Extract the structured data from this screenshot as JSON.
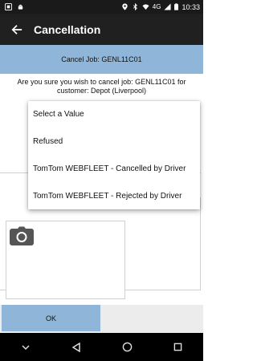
{
  "status_bar": {
    "time": "10:33",
    "network": "4G",
    "left_icons": [
      "app-notification-icon",
      "android-icon"
    ],
    "right_icons": [
      "location-icon",
      "bluetooth-icon",
      "wifi-icon",
      "signal-icon",
      "battery-icon"
    ]
  },
  "app_bar": {
    "title": "Cancellation",
    "back_icon": "arrow-back-icon"
  },
  "subheader": {
    "text": "Cancel Job: GENL11C01"
  },
  "question": {
    "text": "Are you sure you wish to cancel job: GENL11C01 for customer: Depot (Liverpool)"
  },
  "dropdown": {
    "options": [
      "Select a Value",
      "Refused",
      "TomTom WEBFLEET - Cancelled by Driver",
      "TomTom WEBFLEET - Rejected by Driver"
    ]
  },
  "photo": {
    "icon": "camera-icon"
  },
  "ok_button": {
    "label": "OK"
  },
  "nav_bar": {
    "icons": [
      "chevron-down-icon",
      "back-triangle-icon",
      "home-circle-icon",
      "recents-square-icon"
    ]
  },
  "colors": {
    "accent": "#8fb6d9",
    "app_bar": "#202020",
    "status_bar": "#1a1a1a",
    "nav_bar": "#000000"
  }
}
